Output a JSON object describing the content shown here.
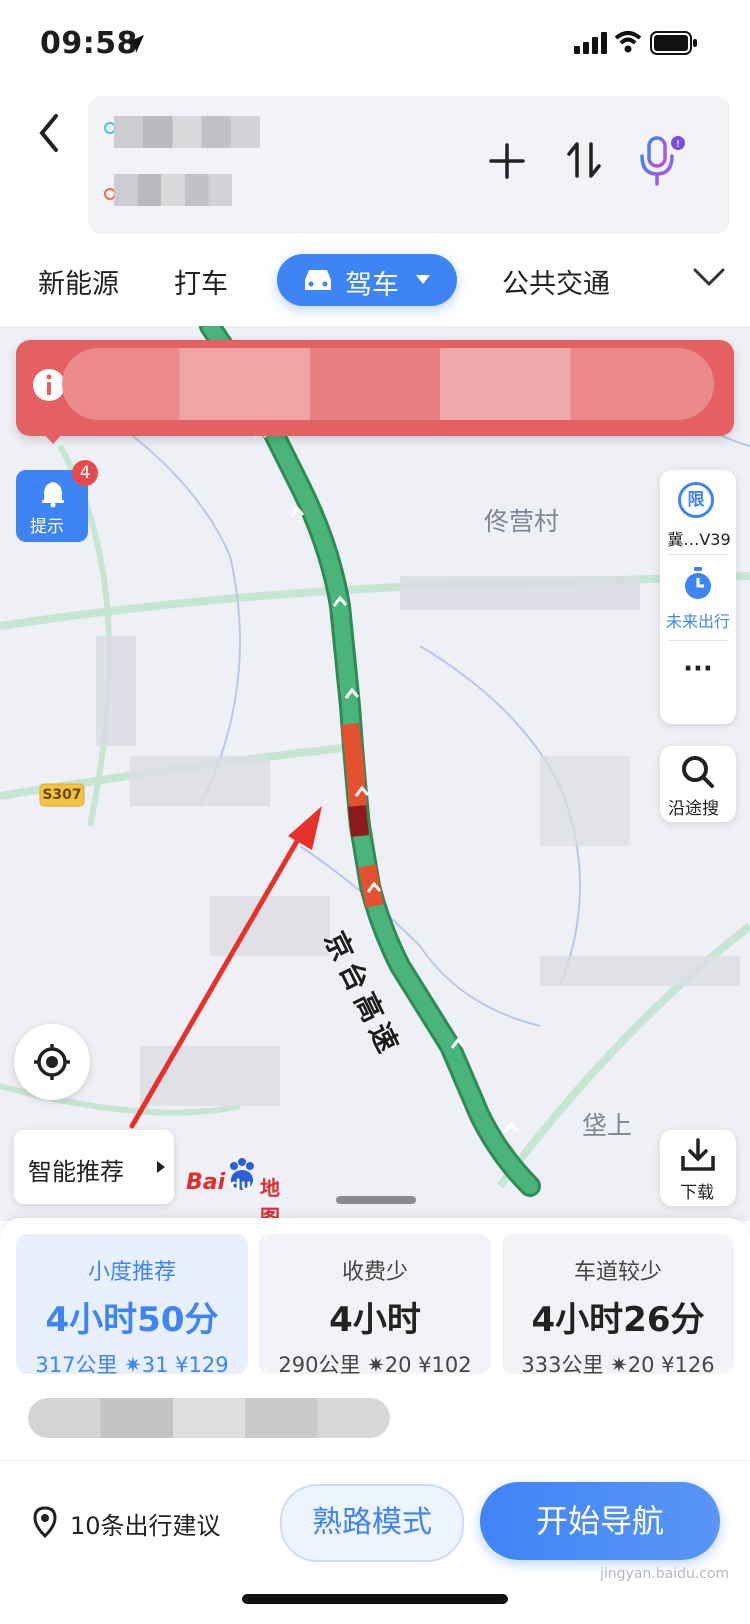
{
  "status_bar": {
    "time": "09:58"
  },
  "tabs": [
    {
      "label": "新能源"
    },
    {
      "label": "打车"
    },
    {
      "label": "驾车",
      "active": true
    },
    {
      "label": "公共交通"
    }
  ],
  "map": {
    "tip_button_label": "提示",
    "tip_badge": "4",
    "place_label_1": "佟营村",
    "place_label_2": "垡上",
    "road_name": "京台高速",
    "road_shield": "S307",
    "side_panel": {
      "restriction_icon_label": "限",
      "restriction_text": "冀…V39",
      "future_trip": "未来出行",
      "more": "···"
    },
    "search_along": "沿途搜",
    "download": "下载",
    "smart_recommend": "智能推荐",
    "brand_text": "Bai",
    "brand_du": "du",
    "brand_map": "地图"
  },
  "routes": [
    {
      "label": "小度推荐",
      "duration": "4小时50分",
      "distance": "317公里",
      "lights": "31",
      "toll": "¥129",
      "selected": true
    },
    {
      "label": "收费少",
      "duration": "4小时",
      "distance": "290公里",
      "lights": "20",
      "toll": "¥102",
      "selected": false
    },
    {
      "label": "车道较少",
      "duration": "4小时26分",
      "distance": "333公里",
      "lights": "20",
      "toll": "¥126",
      "selected": false
    }
  ],
  "footer": {
    "suggestions": "10条出行建议",
    "familiar_mode": "熟路模式",
    "start_nav": "开始导航"
  },
  "watermark": "jingyan.baidu.com",
  "colors": {
    "accent": "#3f84f5",
    "alert": "#e46063",
    "road_green": "#4ab57a",
    "road_red": "#e5502e"
  }
}
